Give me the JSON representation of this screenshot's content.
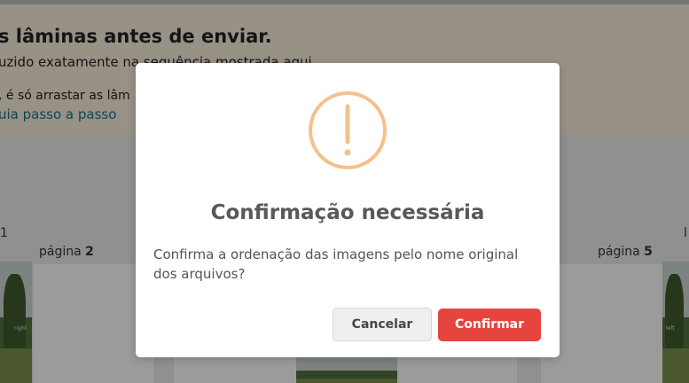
{
  "background": {
    "notice": {
      "title": "s lâminas antes de enviar.",
      "subtitle": "uzido exatamente na sequência mostrada aqui.",
      "drag_text": ", é só arrastar as lâm",
      "guide_link": "uia passo a passo"
    },
    "pages": {
      "left_number_fragment": "1",
      "page2_label_prefix": "página ",
      "page2_number": "2",
      "page5_label_prefix": "página ",
      "page5_number": "5",
      "right_fragment": "l",
      "thumb_tag_right": "right",
      "thumb_tag_left": "left"
    }
  },
  "dialog": {
    "icon": "warning-exclamation-icon",
    "title": "Confirmação necessária",
    "message": "Confirma a ordenação das imagens pelo nome original dos arquivos?",
    "cancel_label": "Cancelar",
    "confirm_label": "Confirmar"
  },
  "colors": {
    "icon": "#f5c08c",
    "confirm": "#e5453e",
    "cancel": "#efefef",
    "notice_bg": "#f4ead9",
    "link": "#1a6f86"
  }
}
